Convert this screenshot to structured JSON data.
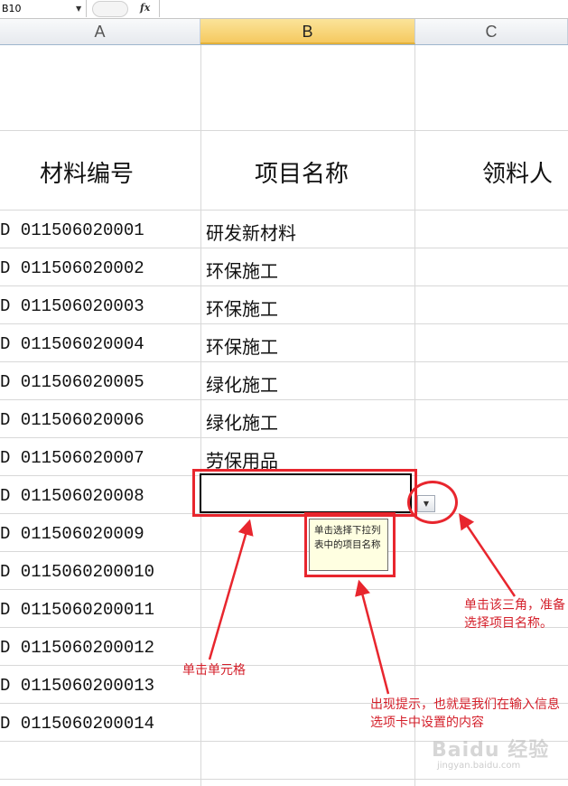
{
  "formula_bar": {
    "namebox": "B10",
    "fx": "fx"
  },
  "columns": [
    {
      "letter": "A"
    },
    {
      "letter": "B"
    },
    {
      "letter": "C"
    }
  ],
  "headers": {
    "material_code": "材料编号",
    "project_name": "项目名称",
    "recipient": "领料人"
  },
  "rows": [
    {
      "code": "D 011506020001",
      "project": "研发新材料"
    },
    {
      "code": "D 011506020002",
      "project": "环保施工"
    },
    {
      "code": "D 011506020003",
      "project": "环保施工"
    },
    {
      "code": "D 011506020004",
      "project": "环保施工"
    },
    {
      "code": "D 011506020005",
      "project": "绿化施工"
    },
    {
      "code": "D 011506020006",
      "project": "绿化施工"
    },
    {
      "code": "D 011506020007",
      "project": "劳保用品"
    },
    {
      "code": "D 011506020008",
      "project": ""
    },
    {
      "code": "D 011506020009",
      "project": ""
    },
    {
      "code": "D 0115060200010",
      "project": ""
    },
    {
      "code": "D 0115060200011",
      "project": ""
    },
    {
      "code": "D 0115060200012",
      "project": ""
    },
    {
      "code": "D 0115060200013",
      "project": ""
    },
    {
      "code": "D 0115060200014",
      "project": ""
    }
  ],
  "tooltip": {
    "text": "单击选择下拉列表中的项目名称"
  },
  "annotations": {
    "click_cell": "单击单元格",
    "click_triangle": "单击该三角，准备选择项目名称。",
    "prompt_appears": "出现提示，也就是我们在输入信息选项卡中设置的内容"
  },
  "watermark": {
    "brand": "Baidu 经验",
    "url": "jingyan.baidu.com"
  },
  "colors": {
    "annotation_red": "#e8262e",
    "tooltip_bg": "#ffffe1",
    "active_col": "#f5c960"
  }
}
